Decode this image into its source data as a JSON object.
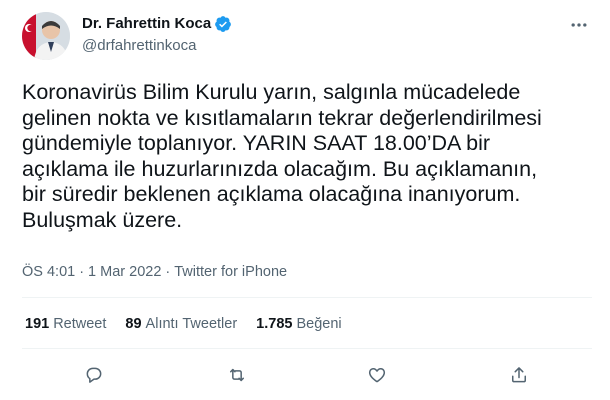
{
  "author": {
    "display_name": "Dr. Fahrettin Koca",
    "handle": "@drfahrettinkoca",
    "verified": true
  },
  "tweet": {
    "text": "Koronavirüs Bilim Kurulu yarın, salgınla mücadelede\ngelinen nokta ve kısıtlamaların tekrar değerlendirilmesi\ngündemiyle toplanıyor. YARIN SAAT 18.00’DA bir\naçıklama ile huzurlarınızda olacağım. Bu açıklamanın,\nbir süredir beklenen açıklama olacağına inanıyorum.\nBuluşmak üzere.",
    "time": "ÖS 4:01",
    "date": "1 Mar 2022",
    "source": "Twitter for iPhone",
    "separator": "·"
  },
  "stats": {
    "retweets_count": "191",
    "retweets_label": "Retweet",
    "quotes_count": "89",
    "quotes_label": "Alıntı Tweetler",
    "likes_count": "1.785",
    "likes_label": "Beğeni"
  },
  "icons": {
    "more": "more-horizontal-icon",
    "reply": "reply-icon",
    "retweet": "retweet-icon",
    "like": "heart-icon",
    "share": "share-icon",
    "verified": "verified-badge-icon"
  },
  "colors": {
    "verified_blue": "#1d9bf0",
    "secondary_text": "#536471",
    "primary_text": "#0f1419"
  }
}
